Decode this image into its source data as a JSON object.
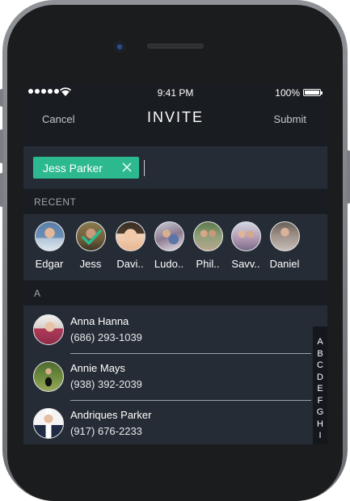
{
  "status_bar": {
    "time": "9:41 PM",
    "battery": "100%"
  },
  "nav": {
    "cancel": "Cancel",
    "title": "INVITE",
    "submit": "Submit"
  },
  "to_field": {
    "chip_label": "Jess Parker"
  },
  "recent": {
    "header": "RECENT",
    "items": [
      {
        "name": "Edgar",
        "selected": false
      },
      {
        "name": "Jess",
        "selected": true
      },
      {
        "name": "Davi..",
        "selected": false
      },
      {
        "name": "Ludo..",
        "selected": false
      },
      {
        "name": "Phil..",
        "selected": false
      },
      {
        "name": "Savv..",
        "selected": false
      },
      {
        "name": "Daniel",
        "selected": false
      }
    ]
  },
  "contacts": {
    "section_header": "A",
    "items": [
      {
        "name": "Anna Hanna",
        "phone": "(686) 293-1039"
      },
      {
        "name": "Annie Mays",
        "phone": "(938) 392-2039"
      },
      {
        "name": "Andriques Parker",
        "phone": "(917) 676-2233"
      }
    ]
  },
  "index_letters": [
    "A",
    "B",
    "C",
    "D",
    "E",
    "F",
    "G",
    "H",
    "I"
  ],
  "colors": {
    "accent": "#2db98f",
    "screen_bg": "#21262d",
    "header_bg": "#191c21"
  },
  "icons": [
    "wifi-icon",
    "battery-icon",
    "close-icon",
    "checkmark-icon"
  ]
}
